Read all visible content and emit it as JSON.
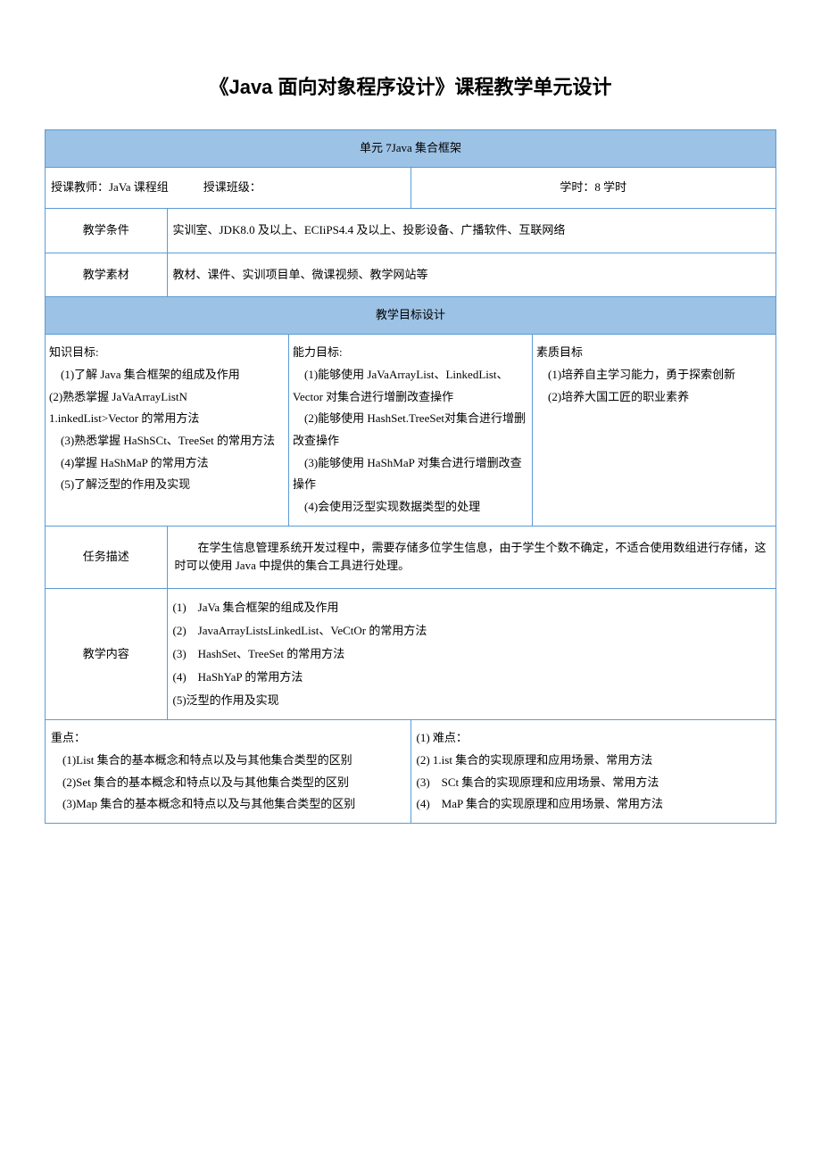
{
  "title": "《Java 面向对象程序设计》课程教学单元设计",
  "unit_header": "单元 7Java 集合框架",
  "info_row": {
    "teacher_label": "授课教师：JaVa 课程组",
    "class_label": "授课班级：",
    "hours_label": "学时：8 学时"
  },
  "conditions": {
    "label": "教学条件",
    "value": "实训室、JDK8.0 及以上、ECIiPS4.4 及以上、投影设备、广播软件、互联网络"
  },
  "materials": {
    "label": "教学素材",
    "value": "教材、课件、实训项目单、微课视频、教学网站等"
  },
  "goals_header": "教学目标设计",
  "knowledge": {
    "title": "知识目标:",
    "items": [
      "(1)了解 Java 集合框架的组成及作用",
      "(2)熟悉掌握 JaVaArrayListN",
      "1.inkedList>Vector 的常用方法",
      "(3)熟悉掌握 HaShSCt、TreeSet 的常用方法",
      "(4)掌握 HaShMaP 的常用方法",
      "(5)了解泛型的作用及实现"
    ]
  },
  "ability": {
    "title": "能力目标:",
    "items": [
      "(1)能够使用 JaVaArrayList、LinkedList、Vector 对集合进行增删改查操作",
      "(2)能够使用 HashSet.TreeSet对集合进行增删改查操作",
      "(3)能够使用 HaShMaP 对集合进行增删改查操作",
      "(4)会使用泛型实现数据类型的处理"
    ]
  },
  "quality": {
    "title": "素质目标",
    "items": [
      "(1)培养自主学习能力，勇于探索创新",
      "(2)培养大国工匠的职业素养"
    ]
  },
  "task": {
    "label": "任务描述",
    "value": "在学生信息管理系统开发过程中，需要存储多位学生信息，由于学生个数不确定，不适合使用数组进行存储，这时可以使用 Java 中提供的集合工具进行处理。"
  },
  "content": {
    "label": "教学内容",
    "items": [
      "(1)　JaVa 集合框架的组成及作用",
      "(2)　JavaArrayListsLinkedList、VeCtOr 的常用方法",
      "(3)　HashSet、TreeSet 的常用方法",
      "(4)　HaShYaP 的常用方法",
      "(5)泛型的作用及实现"
    ]
  },
  "key_points": {
    "title": "重点：",
    "items": [
      "(1)List 集合的基本概念和特点以及与其他集合类型的区别",
      "(2)Set 集合的基本概念和特点以及与其他集合类型的区别",
      "(3)Map 集合的基本概念和特点以及与其他集合类型的区别"
    ]
  },
  "difficulties": {
    "title": "(1) 难点：",
    "items": [
      "(2) 1.ist 集合的实现原理和应用场景、常用方法",
      "(3)　SCt 集合的实现原理和应用场景、常用方法",
      "(4)　MaP 集合的实现原理和应用场景、常用方法"
    ]
  }
}
